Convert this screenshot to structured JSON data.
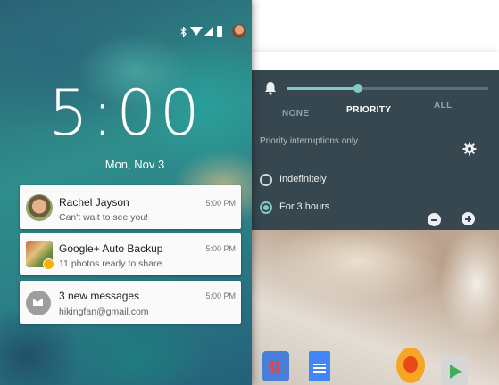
{
  "lock_screen": {
    "time": "5:00",
    "date": "Mon, Nov 3",
    "notifications": [
      {
        "title": "Rachel Jayson",
        "body": "Can't wait to see you!",
        "time": "5:00 PM",
        "icon": "avatar-rachel"
      },
      {
        "title": "Google+ Auto Backup",
        "body": "11 photos ready to share",
        "time": "5:00 PM",
        "icon": "photos-thumbnail"
      },
      {
        "title": "3 new messages",
        "body": "hikingfan@gmail.com",
        "time": "5:00 PM",
        "icon": "mail-icon"
      }
    ],
    "status_icons": [
      "bluetooth-icon",
      "wifi-icon",
      "signal-icon",
      "battery-icon",
      "avatar-icon"
    ]
  },
  "interruptions_panel": {
    "volume_level": 0.35,
    "modes": [
      "NONE",
      "PRIORITY",
      "ALL"
    ],
    "selected_mode": "PRIORITY",
    "subtitle": "Priority interruptions only",
    "duration_options": [
      {
        "label": "Indefinitely",
        "checked": false
      },
      {
        "label": "For 3 hours",
        "checked": true
      }
    ],
    "icons": [
      "bell-icon",
      "gear-icon",
      "minus-icon",
      "plus-icon"
    ]
  },
  "home_dock": [
    "google-search-icon",
    "google-docs-icon",
    "lenses-icon",
    "play-store-icon"
  ],
  "colors": {
    "accent": "#80cbc4",
    "panel_bg": "#37474f"
  }
}
